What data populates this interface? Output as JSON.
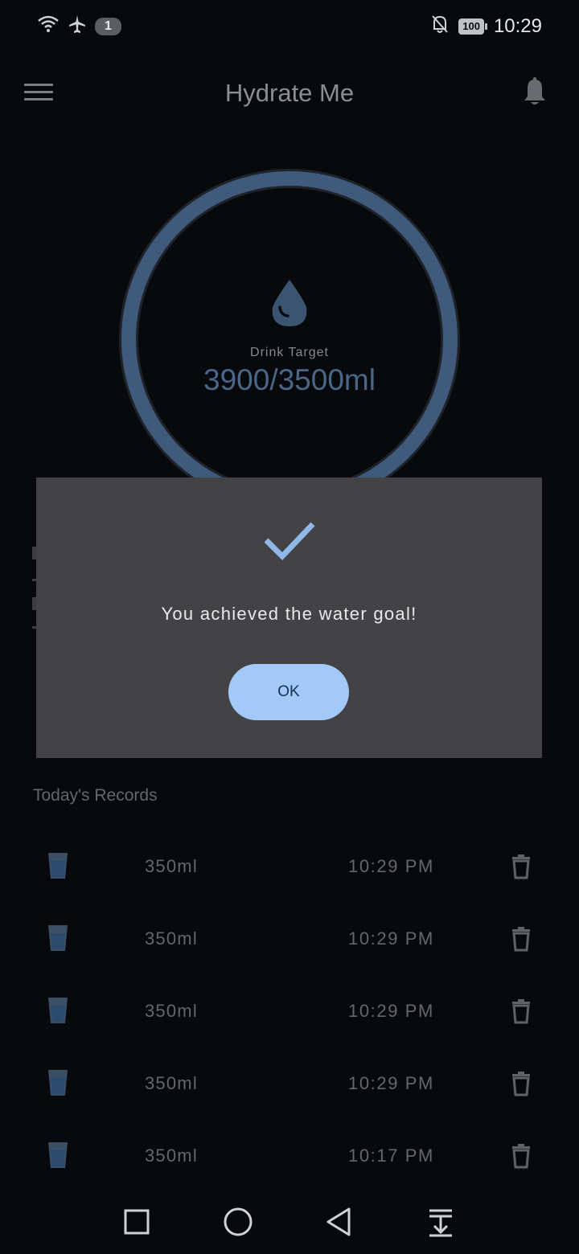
{
  "status_bar": {
    "notification_count": "1",
    "battery": "100",
    "time": "10:29",
    "icons": [
      "wifi-icon",
      "airplane-icon",
      "mute-icon",
      "battery-icon"
    ]
  },
  "app_bar": {
    "title": "Hydrate Me",
    "menu_icon": "menu-icon",
    "bell_icon": "bell-icon"
  },
  "progress": {
    "label": "Drink Target",
    "value_text": "3900/3500ml",
    "consumed_ml": 3900,
    "target_ml": 3500,
    "fraction": 1.0
  },
  "dialog": {
    "message": "You achieved the water goal!",
    "ok_label": "OK",
    "icon": "check-icon"
  },
  "records": {
    "title": "Today's Records",
    "items": [
      {
        "amount": "350ml",
        "time": "10:29 PM"
      },
      {
        "amount": "350ml",
        "time": "10:29 PM"
      },
      {
        "amount": "350ml",
        "time": "10:29 PM"
      },
      {
        "amount": "350ml",
        "time": "10:29 PM"
      },
      {
        "amount": "350ml",
        "time": "10:17 PM"
      }
    ]
  },
  "nav": [
    "recents-icon",
    "home-icon",
    "back-icon",
    "notification-shade-icon"
  ],
  "colors": {
    "background": "#08090c",
    "ring": "#405a7c",
    "accent": "#a2c9f7",
    "dialog": "#434345"
  }
}
